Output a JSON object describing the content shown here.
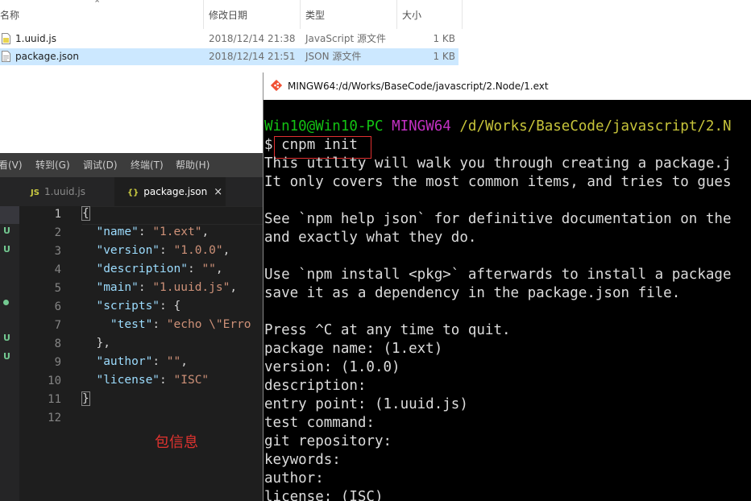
{
  "explorer": {
    "columns": {
      "name": "名称",
      "date": "修改日期",
      "type": "类型",
      "size": "大小"
    },
    "files": [
      {
        "name": "1.uuid.js",
        "date": "2018/12/14 21:38",
        "type": "JavaScript 源文件",
        "size": "1 KB",
        "icon": "js-file-icon"
      },
      {
        "name": "package.json",
        "date": "2018/12/14 21:51",
        "type": "JSON 源文件",
        "size": "1 KB",
        "icon": "json-file-icon",
        "selected": true
      }
    ]
  },
  "vscode": {
    "menu": [
      "看(V)",
      "转到(G)",
      "调试(D)",
      "终端(T)",
      "帮助(H)"
    ],
    "tabs": [
      {
        "label": "1.uuid.js",
        "icon": "JS",
        "active": false
      },
      {
        "label": "package.json",
        "icon": "{}",
        "active": true,
        "close": "×"
      }
    ],
    "git_markers": [
      "U",
      "U",
      "U",
      "U"
    ],
    "line_numbers": [
      "1",
      "2",
      "3",
      "4",
      "5",
      "6",
      "7",
      "8",
      "9",
      "10",
      "11",
      "12"
    ],
    "code": {
      "l1": "{",
      "l2_key": "\"name\"",
      "l2_val": "\"1.ext\"",
      "l3_key": "\"version\"",
      "l3_val": "\"1.0.0\"",
      "l4_key": "\"description\"",
      "l4_val": "\"\"",
      "l5_key": "\"main\"",
      "l5_val": "\"1.uuid.js\"",
      "l6_key": "\"scripts\"",
      "l7_key": "\"test\"",
      "l7_val": "\"echo \\\"Erro",
      "l8": "},",
      "l9_key": "\"author\"",
      "l9_val": "\"\"",
      "l10_key": "\"license\"",
      "l10_val": "\"ISC\"",
      "l11": "}"
    },
    "annotation": "包信息"
  },
  "terminal": {
    "title": "MINGW64:/d/Works/BaseCode/javascript/2.Node/1.ext",
    "prompt_user": "Win10@Win10-PC",
    "prompt_env": "MINGW64",
    "prompt_path": "/d/Works/BaseCode/javascript/2.N",
    "prompt_symbol": "$",
    "command": "cnpm init",
    "lines": [
      "This utility will walk you through creating a package.j",
      "It only covers the most common items, and tries to gues",
      "",
      "See `npm help json` for definitive documentation on the",
      "and exactly what they do.",
      "",
      "Use `npm install <pkg>` afterwards to install a package",
      "save it as a dependency in the package.json file.",
      "",
      "Press ^C at any time to quit.",
      "package name: (1.ext)",
      "version: (1.0.0)",
      "description:",
      "entry point: (1.uuid.js)",
      "test command:",
      "git repository:",
      "keywords:",
      "author:",
      "license: (ISC)"
    ]
  },
  "colors": {
    "terminal_green": "#13c313",
    "terminal_magenta": "#c330c3",
    "terminal_yellow": "#c7c43a",
    "highlight_red": "#e03030",
    "selection_blue": "#cce8ff"
  }
}
